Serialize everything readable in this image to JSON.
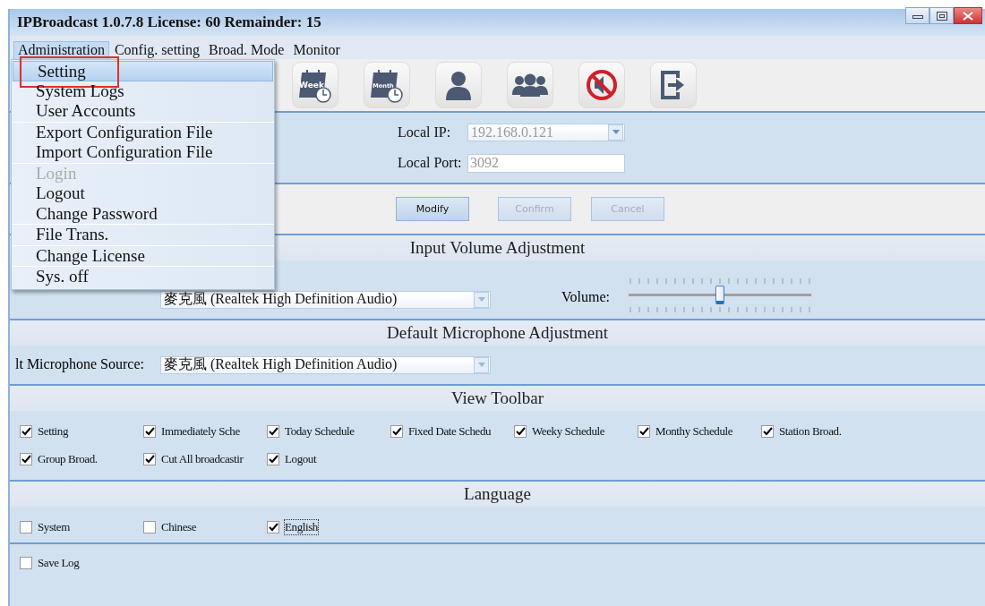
{
  "window": {
    "title": "IPBroadcast 1.0.7.8 License: 60 Remainder: 15"
  },
  "menubar": [
    {
      "label": "Administration",
      "selected": true
    },
    {
      "label": "Config. setting",
      "selected": false
    },
    {
      "label": "Broad. Mode",
      "selected": false
    },
    {
      "label": "Monitor",
      "selected": false
    }
  ],
  "menu": {
    "groups": [
      [
        {
          "label": "Setting",
          "selected": true,
          "disabled": false
        },
        {
          "label": "System Logs",
          "selected": false,
          "disabled": false
        },
        {
          "label": "User Accounts",
          "selected": false,
          "disabled": false
        }
      ],
      [
        {
          "label": "Export Configuration File",
          "selected": false,
          "disabled": false
        },
        {
          "label": "Import Configuration File",
          "selected": false,
          "disabled": false
        }
      ],
      [
        {
          "label": "Login",
          "selected": false,
          "disabled": true
        },
        {
          "label": "Logout",
          "selected": false,
          "disabled": false
        },
        {
          "label": "Change Password",
          "selected": false,
          "disabled": false
        }
      ],
      [
        {
          "label": "File Trans.",
          "selected": false,
          "disabled": false
        }
      ],
      [
        {
          "label": "Change License",
          "selected": false,
          "disabled": false
        }
      ],
      [
        {
          "label": "Sys. off",
          "selected": false,
          "disabled": false
        }
      ]
    ]
  },
  "toolbar": [
    {
      "kind": "week",
      "label": "Week"
    },
    {
      "kind": "month",
      "label": "Month"
    },
    {
      "kind": "user"
    },
    {
      "kind": "group"
    },
    {
      "kind": "mute"
    },
    {
      "kind": "exit"
    }
  ],
  "network": {
    "local_ip": {
      "label": "Local IP:",
      "value": "192.168.0.121",
      "disabled": true
    },
    "local_port": {
      "label": "Local Port:",
      "value": "3092",
      "disabled": true
    }
  },
  "buttons": [
    {
      "label": "Modify",
      "disabled": false
    },
    {
      "label": "Confirm",
      "disabled": true
    },
    {
      "label": "Cancel",
      "disabled": true
    }
  ],
  "input_volume": {
    "title": "Input Volume Adjustment",
    "source_value": "麥克風 (Realtek High Definition Audio)",
    "volume_label": "Volume:",
    "level": 0.5
  },
  "default_microphone": {
    "title": "Default Microphone Adjustment",
    "source_label": "lt Microphone Source:",
    "source_value": "麥克風 (Realtek High Definition Audio)"
  },
  "view_toolbar": {
    "title": "View Toolbar",
    "rows": [
      [
        {
          "label": "Setting",
          "checked": true
        },
        {
          "label": "Immediately Sche",
          "checked": true
        },
        {
          "label": "Today Schedule",
          "checked": true
        },
        {
          "label": "Fixed Date Schedu",
          "checked": true
        },
        {
          "label": "Weeky Schedule",
          "checked": true
        },
        {
          "label": "Monthy Schedule",
          "checked": true
        },
        {
          "label": "Station Broad.",
          "checked": true
        }
      ],
      [
        {
          "label": "Group Broad.",
          "checked": true
        },
        {
          "label": "Cut All broadcastir",
          "checked": true
        },
        {
          "label": "Logout",
          "checked": true
        }
      ]
    ]
  },
  "language": {
    "title": "Language",
    "options": [
      {
        "label": "System",
        "checked": false,
        "focused": false
      },
      {
        "label": "Chinese",
        "checked": false,
        "focused": false
      },
      {
        "label": "English",
        "checked": true,
        "focused": true
      }
    ]
  },
  "save_log": {
    "label": "Save Log",
    "checked": false
  }
}
